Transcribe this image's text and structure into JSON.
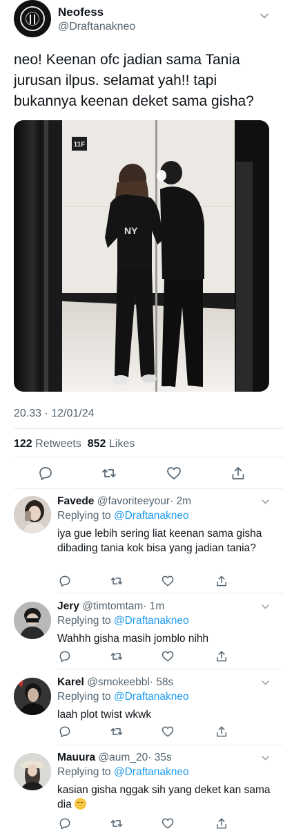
{
  "tweet": {
    "author_name": "Neofess",
    "author_handle": "@Draftanakneo",
    "text": "neo! Keenan ofc jadian sama Tania jurusan ilpus. selamat yah!! tapi bukannya keenan deket sama gisha?",
    "photo_sign_text": "11F",
    "timestamp": "20.33 · 12/01/24",
    "retweets_count": "122",
    "retweets_label": "Retweets",
    "likes_count": "852",
    "likes_label": "Likes"
  },
  "icons": {
    "reply": "reply-icon",
    "retweet": "retweet-icon",
    "like": "heart-icon",
    "share": "share-icon",
    "more": "chevron-down-icon"
  },
  "replies": [
    {
      "name": "Favede",
      "handle": "@favoriteeyour",
      "time": "· 2m",
      "replying_prefix": "Replying to",
      "replying_to": "@Draftanakneo",
      "text": "iya gue lebih sering liat keenan sama gisha dibading tania kok bisa yang jadian tania?"
    },
    {
      "name": "Jery",
      "handle": "@timtomtam",
      "time": "· 1m",
      "replying_prefix": "Replying to",
      "replying_to": "@Draftanakneo",
      "text": "Wahhh gisha masih jomblo nihh"
    },
    {
      "name": "Karel",
      "handle": "@smokeebbl",
      "time": "· 58s",
      "replying_prefix": "Replying to",
      "replying_to": "@Draftanakneo",
      "text": "laah plot twist wkwk"
    },
    {
      "name": "Mauura",
      "handle": "@aum_20",
      "time": "· 35s",
      "replying_prefix": "Replying to",
      "replying_to": "@Draftanakneo",
      "text": "kasian gisha nggak sih yang deket kan sama dia"
    }
  ],
  "colors": {
    "text": "#0f1419",
    "secondary": "#536471",
    "link": "#1d9bf0",
    "divider": "#e6e9ec"
  }
}
